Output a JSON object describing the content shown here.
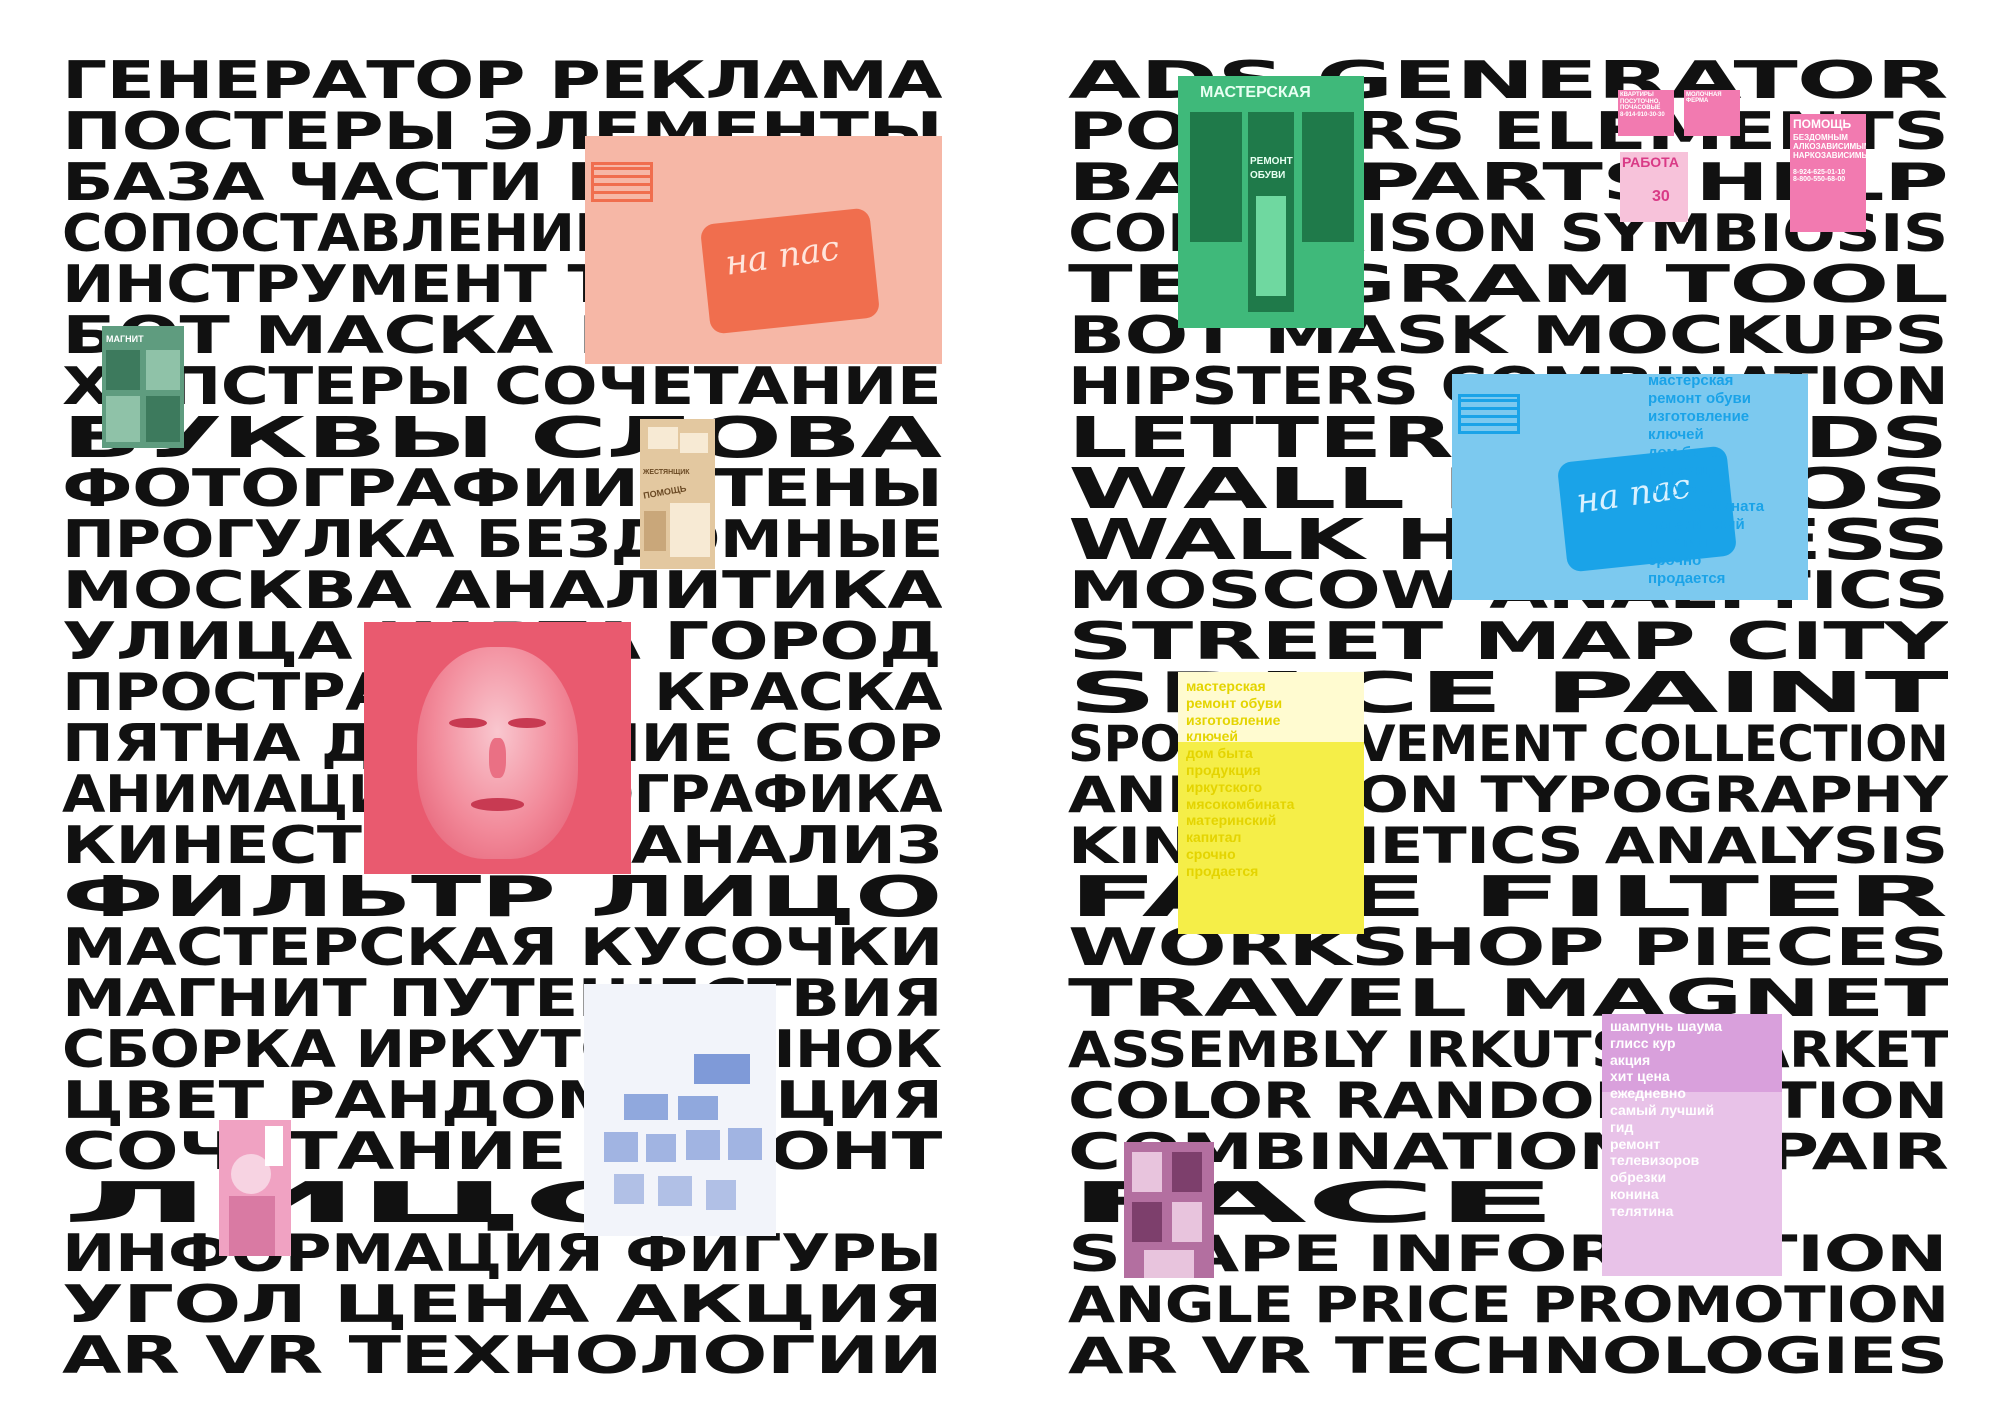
{
  "left_poster": {
    "lines": [
      {
        "text": "ГЕНЕРАТОР РЕКЛАМА",
        "style": "wide"
      },
      {
        "text": "ПОСТЕРЫ ЭЛЕМЕНТЫ",
        "style": "wide"
      },
      {
        "text": "БАЗА ЧАСТИ ПОМОЩЬ",
        "style": "wide"
      },
      {
        "text": "СОПОСТАВЛЕНИЕ СИМБИОЗ",
        "style": "wide"
      },
      {
        "text": "ИНСТРУМЕНТ ТЕЛЕГРАМ",
        "style": "wide"
      },
      {
        "text": "БОТ МАСКА МАКЕТЫ",
        "style": "wide"
      },
      {
        "text": "ХИПСТЕРЫ СОЧЕТАНИЕ",
        "style": "wide"
      },
      {
        "text": "БУКВЫ СЛОВА",
        "style": "extended"
      },
      {
        "text": "ФОТОГРАФИИ СТЕНЫ",
        "style": "wide"
      },
      {
        "text": "ПРОГУЛКА БЕЗДОМНЫЕ",
        "style": "wide"
      },
      {
        "text": "МОСКВА АНАЛИТИКА",
        "style": "wide"
      },
      {
        "text": "УЛИЦА КАРТА ГОРОД",
        "style": "wide"
      },
      {
        "text": "ПРОСТРАНСТВО КРАСКА",
        "style": "wide"
      },
      {
        "text": "ПЯТНА ДВИЖЕНИЕ СБОР",
        "style": "wide"
      },
      {
        "text": "АНИМАЦИЯ ТИПОГРАФИКА",
        "style": "wide"
      },
      {
        "text": "КИНЕСТЕТИКА АНАЛИЗ",
        "style": "wide"
      },
      {
        "text": "ФИЛЬТР ЛИЦО",
        "style": "extended"
      },
      {
        "text": "МАСТЕРСКАЯ КУСОЧКИ",
        "style": "wide"
      },
      {
        "text": "МАГНИТ ПУТЕШЕСТВИЯ",
        "style": "wide"
      },
      {
        "text": "СБОРКА ИРКУТСК РЫНОК",
        "style": "wide"
      },
      {
        "text": "ЦВЕТ РАНДОМИЗАЦИЯ",
        "style": "wide"
      },
      {
        "text": "СОЧЕТАНИЕ РЕМОНТ",
        "style": "wide"
      },
      {
        "text": "ЛИЦО",
        "style": "extended"
      },
      {
        "text": "ИНФОРМАЦИЯ ФИГУРЫ",
        "style": "wide"
      },
      {
        "text": "УГОЛ ЦЕНА АКЦИЯ",
        "style": "wide"
      },
      {
        "text": "AR VR ТЕХНОЛОГИИ",
        "style": "wide"
      }
    ]
  },
  "right_poster": {
    "lines": [
      {
        "text": "ADS GENERATOR",
        "style": "wide"
      },
      {
        "text": "POSTERS ELEMENTS",
        "style": "wide"
      },
      {
        "text": "BASE PARTS HELP",
        "style": "wide"
      },
      {
        "text": "COMPARISON SYMBIOSIS",
        "style": "wide"
      },
      {
        "text": "TELEGRAM TOOL",
        "style": "wide"
      },
      {
        "text": "BOT MASK MOCKUPS",
        "style": "wide"
      },
      {
        "text": "HIPSTERS COMBINATION",
        "style": "wide"
      },
      {
        "text": "LETTERS WORDS",
        "style": "extended"
      },
      {
        "text": "WALL PHOTOS",
        "style": "extended"
      },
      {
        "text": "WALK HOMELESS",
        "style": "extended"
      },
      {
        "text": "MOSCOW ANALYTICS",
        "style": "wide"
      },
      {
        "text": "STREET MAP CITY",
        "style": "wide"
      },
      {
        "text": "SPACE PAINT",
        "style": "extended"
      },
      {
        "text": "SPOTS MOVEMENT COLLECTION",
        "style": "condensed"
      },
      {
        "text": "ANIMATION TYPOGRAPHY",
        "style": "condensed"
      },
      {
        "text": "KINESTHETICS ANALYSIS",
        "style": "condensed"
      },
      {
        "text": "FACE FILTER",
        "style": "extended"
      },
      {
        "text": "WORKSHOP PIECES",
        "style": "wide"
      },
      {
        "text": "TRAVEL MAGNET",
        "style": "wide"
      },
      {
        "text": "ASSEMBLY IRKUTSK MARKET",
        "style": "condensed"
      },
      {
        "text": "COLOR RANDOMIZATION",
        "style": "condensed"
      },
      {
        "text": "COMBINATION REPAIR",
        "style": "condensed"
      },
      {
        "text": "FACE",
        "style": "extended"
      },
      {
        "text": "SHAPE INFORMATION",
        "style": "condensed"
      },
      {
        "text": "ANGLE PRICE PROMOTION",
        "style": "condensed"
      },
      {
        "text": "AR VR TECHNOLOGIES",
        "style": "condensed"
      }
    ]
  },
  "collages": {
    "salmon_wall": {
      "graffiti": "на пас",
      "bg": "#f6b7a6",
      "accent": "#f06e4e"
    },
    "green_magnit": {
      "label": "МАГНИТ",
      "bg": "#5f9c7f"
    },
    "tan_posters": {
      "label": "ЖЕСТЯНЩИК",
      "label2": "ПОМОЩЬ",
      "bg": "#e3c8a0"
    },
    "pink_face": {
      "bg": "#e95a6f"
    },
    "blue_flyers": {
      "bg": "#f2f4fa",
      "accent": "#4f74c9"
    },
    "pink_portrait": {
      "bg": "#f0a2c2"
    },
    "green_shop": {
      "sign": "МАСТЕРСКАЯ",
      "line1": "РЕМОНТ",
      "line2": "ОБУВИ",
      "bg": "#3fb97a"
    },
    "pink_ads": {
      "a1": "КВАРТИРЫ ПОСУТОЧНО, ПОЧАСОВЫЕ",
      "a2": "8-914-910-30-30",
      "a3": "РАБОТА",
      "a4": "30",
      "a5": "МОЛОЧНАЯ ФЕРМА",
      "bg": "#f27ab0"
    },
    "pink_pomosh": {
      "title": "ПОМОЩЬ",
      "body": "БЕЗДОМНЫМ АЛКОЗАВИСИМЫМ НАРКОЗАВИСИМЫМ",
      "phone1": "8-924-625-01-10",
      "phone2": "8-800-550-68-00",
      "bg": "#f27ab0"
    },
    "blue_wall": {
      "graffiti": "на пас",
      "list": [
        "мастерская",
        "ремонт обуви",
        "изготовление",
        "ключей",
        "дом быта",
        "продукция",
        "иркутского",
        "мясокомбината",
        "материнский",
        "капитал",
        "срочно",
        "продается"
      ],
      "bg": "#7cc9ef",
      "accent": "#1aa3e8"
    },
    "yellow_list": {
      "list": [
        "мастерская",
        "ремонт обуви",
        "изготовление",
        "ключей",
        "дом быта",
        "продукция",
        "иркутского",
        "мясокомбината",
        "материнский",
        "капитал",
        "срочно",
        "продается"
      ],
      "bg": "#fffbd0",
      "accent": "#f5ee48",
      "text": "#e4d400"
    },
    "lilac_list": {
      "list": [
        "шампунь шаума",
        "глисс кур",
        "акция",
        "хит цена",
        "ежедневно",
        "самый лучший",
        "гид",
        "ремонт",
        "телевизоров",
        "обрезки",
        "конина",
        "телятина"
      ],
      "bg": "#e8c2e8",
      "accent": "#d9a0dc",
      "text": "#ffffff"
    },
    "mauve_building": {
      "bg": "#b36fa0"
    }
  }
}
